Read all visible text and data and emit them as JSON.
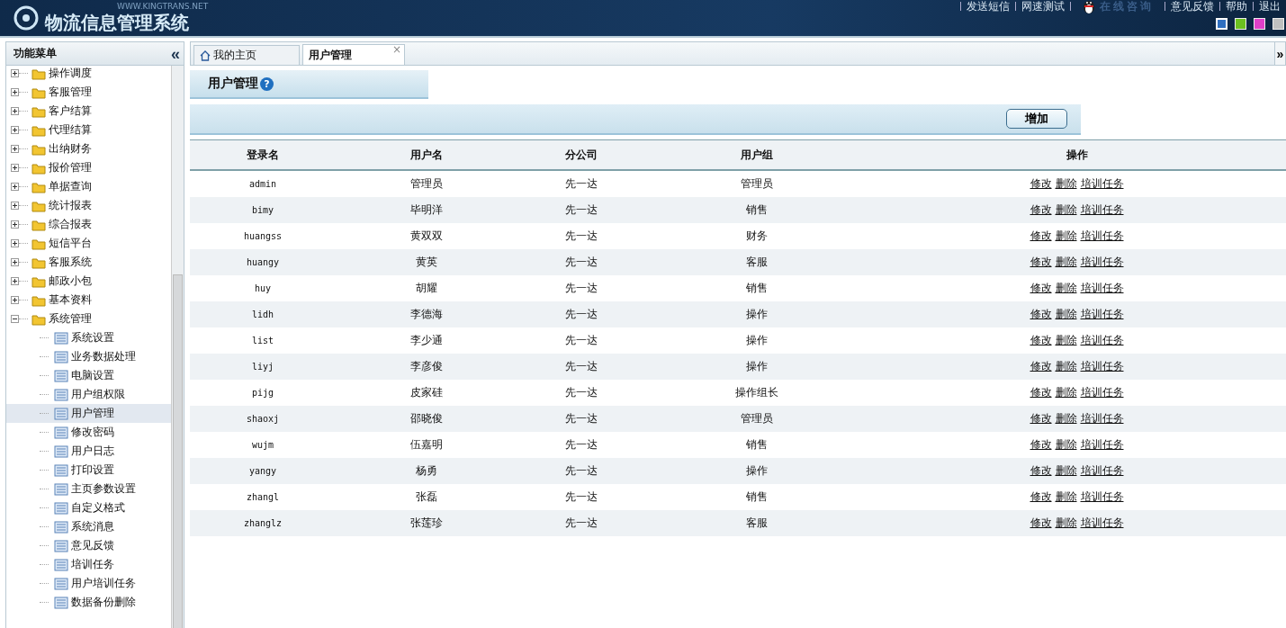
{
  "header": {
    "site": "WWW.KINGTRANS.NET",
    "title": "物流信息管理系统",
    "links": [
      "发送短信",
      "网速测试"
    ],
    "qq_label": "在线咨询",
    "links_right": [
      "意见反馈",
      "帮助",
      "退出"
    ],
    "themes": [
      {
        "color": "#2f6fc0",
        "selected": true
      },
      {
        "color": "#6cc020",
        "selected": false
      },
      {
        "color": "#e040c8",
        "selected": false
      },
      {
        "color": "#c0c0c0",
        "selected": false
      }
    ]
  },
  "sidebar": {
    "title": "功能菜单",
    "collapse": "«",
    "tree": [
      {
        "label": "操作调度",
        "expanded": false,
        "selected": false
      },
      {
        "label": "客服管理",
        "expanded": false,
        "selected": false
      },
      {
        "label": "客户结算",
        "expanded": false,
        "selected": false
      },
      {
        "label": "代理结算",
        "expanded": false,
        "selected": false
      },
      {
        "label": "出纳财务",
        "expanded": false,
        "selected": false
      },
      {
        "label": "报价管理",
        "expanded": false,
        "selected": false
      },
      {
        "label": "单据查询",
        "expanded": false,
        "selected": false
      },
      {
        "label": "统计报表",
        "expanded": false,
        "selected": false
      },
      {
        "label": "综合报表",
        "expanded": false,
        "selected": false
      },
      {
        "label": "短信平台",
        "expanded": false,
        "selected": false
      },
      {
        "label": "客服系统",
        "expanded": false,
        "selected": false
      },
      {
        "label": "邮政小包",
        "expanded": false,
        "selected": false
      },
      {
        "label": "基本资料",
        "expanded": false,
        "selected": false
      },
      {
        "label": "系统管理",
        "expanded": true,
        "selected": false,
        "children": [
          {
            "label": "系统设置",
            "selected": false
          },
          {
            "label": "业务数据处理",
            "selected": false
          },
          {
            "label": "电脑设置",
            "selected": false
          },
          {
            "label": "用户组权限",
            "selected": false
          },
          {
            "label": "用户管理",
            "selected": true
          },
          {
            "label": "修改密码",
            "selected": false
          },
          {
            "label": "用户日志",
            "selected": false
          },
          {
            "label": "打印设置",
            "selected": false
          },
          {
            "label": "主页参数设置",
            "selected": false
          },
          {
            "label": "自定义格式",
            "selected": false
          },
          {
            "label": "系统消息",
            "selected": false
          },
          {
            "label": "意见反馈",
            "selected": false
          },
          {
            "label": "培训任务",
            "selected": false
          },
          {
            "label": "用户培训任务",
            "selected": false
          },
          {
            "label": "数据备份删除",
            "selected": false
          }
        ]
      }
    ]
  },
  "tabs": [
    {
      "label": "我的主页",
      "selected": false,
      "kind": "home"
    },
    {
      "label": "用户管理",
      "selected": true,
      "kind": "closable",
      "close": "×"
    }
  ],
  "tab_more": "»",
  "panel": {
    "title": "用户管理",
    "help": "?",
    "add_button": "增加"
  },
  "table": {
    "columns": [
      "登录名",
      "用户名",
      "分公司",
      "用户组",
      "操作"
    ],
    "rows": [
      {
        "cells": [
          "admin",
          "管理员",
          "先一达",
          "管理员"
        ],
        "actions": [
          "修改",
          "删除",
          "培训任务"
        ]
      },
      {
        "cells": [
          "bimy",
          "毕明洋",
          "先一达",
          "销售"
        ],
        "actions": [
          "修改",
          "删除",
          "培训任务"
        ]
      },
      {
        "cells": [
          "huangss",
          "黄双双",
          "先一达",
          "财务"
        ],
        "actions": [
          "修改",
          "删除",
          "培训任务"
        ]
      },
      {
        "cells": [
          "huangy",
          "黄英",
          "先一达",
          "客服"
        ],
        "actions": [
          "修改",
          "删除",
          "培训任务"
        ]
      },
      {
        "cells": [
          "huy",
          "胡耀",
          "先一达",
          "销售"
        ],
        "actions": [
          "修改",
          "删除",
          "培训任务"
        ]
      },
      {
        "cells": [
          "lidh",
          "李德海",
          "先一达",
          "操作"
        ],
        "actions": [
          "修改",
          "删除",
          "培训任务"
        ]
      },
      {
        "cells": [
          "list",
          "李少通",
          "先一达",
          "操作"
        ],
        "actions": [
          "修改",
          "删除",
          "培训任务"
        ]
      },
      {
        "cells": [
          "liyj",
          "李彦俊",
          "先一达",
          "操作"
        ],
        "actions": [
          "修改",
          "删除",
          "培训任务"
        ]
      },
      {
        "cells": [
          "pijg",
          "皮家硅",
          "先一达",
          "操作组长"
        ],
        "actions": [
          "修改",
          "删除",
          "培训任务"
        ]
      },
      {
        "cells": [
          "shaoxj",
          "邵晓俊",
          "先一达",
          "管理员"
        ],
        "actions": [
          "修改",
          "删除",
          "培训任务"
        ]
      },
      {
        "cells": [
          "wujm",
          "伍嘉明",
          "先一达",
          "销售"
        ],
        "actions": [
          "修改",
          "删除",
          "培训任务"
        ]
      },
      {
        "cells": [
          "yangy",
          "杨勇",
          "先一达",
          "操作"
        ],
        "actions": [
          "修改",
          "删除",
          "培训任务"
        ]
      },
      {
        "cells": [
          "zhangl",
          "张磊",
          "先一达",
          "销售"
        ],
        "actions": [
          "修改",
          "删除",
          "培训任务"
        ]
      },
      {
        "cells": [
          "zhanglz",
          "张莲珍",
          "先一达",
          "客服"
        ],
        "actions": [
          "修改",
          "删除",
          "培训任务"
        ]
      }
    ]
  }
}
